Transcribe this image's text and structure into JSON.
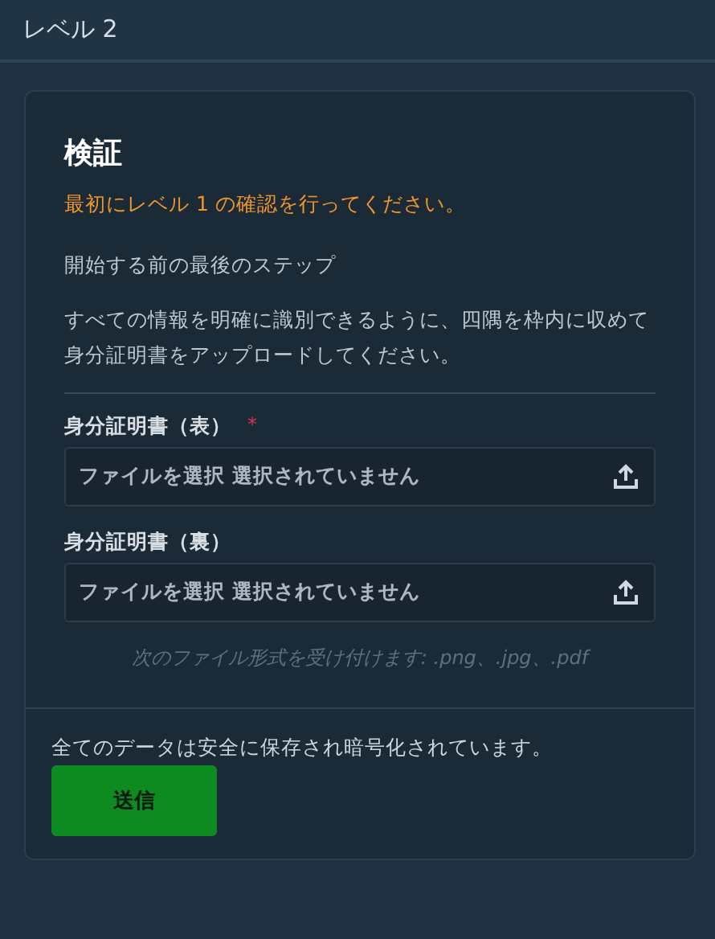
{
  "header": {
    "title": "レベル 2"
  },
  "card": {
    "title": "検証",
    "warning": "最初にレベル 1 の確認を行ってください。",
    "subtitle": "開始する前の最後のステップ",
    "instructions": "すべての情報を明確に識別できるように、四隅を枠内に収めて身分証明書をアップロードしてください。",
    "fields": [
      {
        "label": "身分証明書（表）",
        "required_mark": "*",
        "text": "ファイルを選択 選択されていません"
      },
      {
        "label": "身分証明書（裏）",
        "text": "ファイルを選択 選択されていません"
      }
    ],
    "formats_note": "次のファイル形式を受け付けます: .png、.jpg、.pdf",
    "footer_note": "全てのデータは安全に保存され暗号化されています。",
    "submit": "送信"
  }
}
